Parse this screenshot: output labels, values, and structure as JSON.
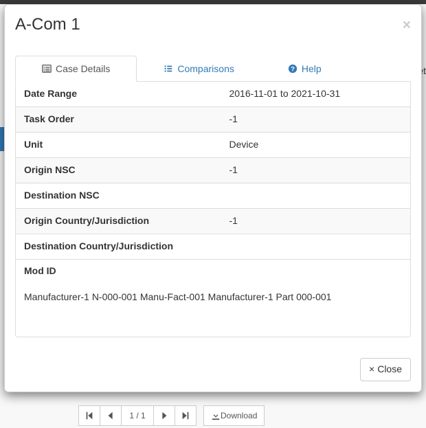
{
  "background": {
    "detLabel": "Det",
    "pager": {
      "first": "⏮",
      "prev": "‹",
      "pageText": "1 / 1",
      "next": "›",
      "last": "⏭",
      "download": "Download",
      "downloadIcon": "⭳"
    }
  },
  "modal": {
    "title": "A-Com 1",
    "closeX": "×",
    "tabs": {
      "caseDetails": "Case Details",
      "comparisons": "Comparisons",
      "help": "Help"
    },
    "details": [
      {
        "label": "Date Range",
        "value": "2016-11-01 to 2021-10-31",
        "striped": false
      },
      {
        "label": "Task Order",
        "value": "-1",
        "striped": true
      },
      {
        "label": "Unit",
        "value": "Device",
        "striped": false
      },
      {
        "label": "Origin NSC",
        "value": "-1",
        "striped": true
      },
      {
        "label": "Destination NSC",
        "value": "",
        "striped": false
      },
      {
        "label": "Origin Country/Jurisdiction",
        "value": "-1",
        "striped": true
      },
      {
        "label": "Destination Country/Jurisdiction",
        "value": "",
        "striped": false
      }
    ],
    "modId": {
      "label": "Mod ID",
      "text": "Manufacturer-1 N-000-001 Manu-Fact-001 Manufacturer-1 Part 000-001"
    },
    "footer": {
      "closeLabel": "Close",
      "closeGlyph": "×"
    }
  }
}
